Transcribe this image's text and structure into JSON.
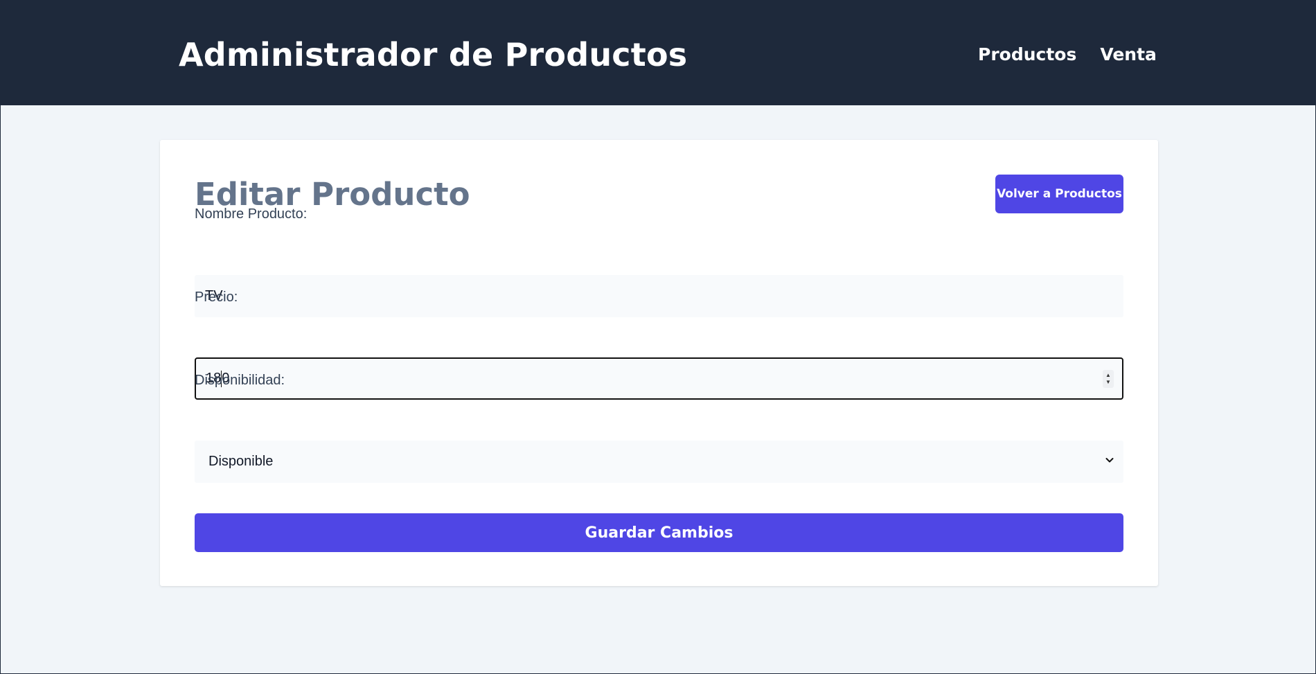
{
  "header": {
    "title": "Administrador de Productos",
    "nav": [
      {
        "label": "Productos"
      },
      {
        "label": "Venta"
      }
    ]
  },
  "card": {
    "title": "Editar Producto",
    "back_button": "Volver a Productos",
    "fields": {
      "name": {
        "label": "Nombre Producto:",
        "value": "TV"
      },
      "price": {
        "label": "Precio:",
        "value_before_caret": "18",
        "value_after_caret": "0"
      },
      "availability": {
        "label": "Disponibilidad:",
        "selected": "Disponible"
      }
    },
    "save_button": "Guardar Cambios"
  },
  "colors": {
    "header_bg": "#1e293b",
    "accent": "#4f46e5",
    "page_bg": "#f1f5f9",
    "title_gray": "#64748b"
  },
  "icons": {
    "spinner": "number-spinner-icon",
    "select": "chevron-down-icon"
  }
}
